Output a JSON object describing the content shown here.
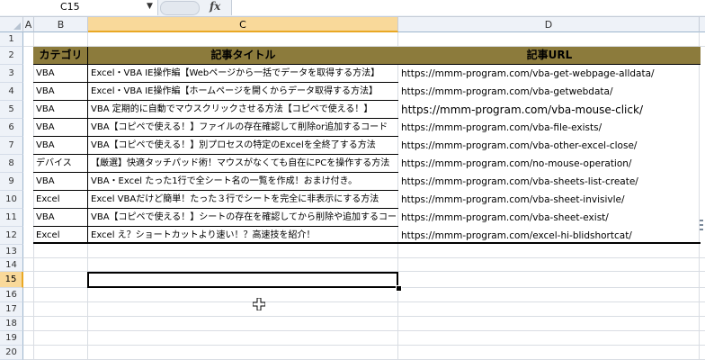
{
  "formula_bar": {
    "name_box": "C15",
    "fx_label": "fx",
    "formula": ""
  },
  "columns": [
    "A",
    "B",
    "C",
    "D"
  ],
  "rows": [
    "1",
    "2",
    "3",
    "4",
    "5",
    "6",
    "7",
    "8",
    "9",
    "10",
    "11",
    "12",
    "13",
    "14",
    "15",
    "16",
    "17",
    "18",
    "19",
    "20"
  ],
  "table": {
    "headers": [
      "カテゴリ",
      "記事タイトル",
      "記事URL"
    ],
    "rows": [
      [
        "VBA",
        "Excel・VBA IE操作編【Webページから一括でデータを取得する方法】",
        "https://mmm-program.com/vba-get-webpage-alldata/"
      ],
      [
        "VBA",
        "Excel・VBA IE操作編【ホームページを開くからデータ取得する方法】",
        "https://mmm-program.com/vba-getwebdata/"
      ],
      [
        "VBA",
        "VBA 定期的に自動でマウスクリックさせる方法【コピペで使える！】",
        "https://mmm-program.com/vba-mouse-click/"
      ],
      [
        "VBA",
        "VBA【コピペで使える！】ファイルの存在確認して削除or追加するコード",
        "https://mmm-program.com/vba-file-exists/"
      ],
      [
        "VBA",
        "VBA【コピペで使える！】別プロセスの特定のExcelを全終了する方法",
        "https://mmm-program.com/vba-other-excel-close/"
      ],
      [
        "デバイス",
        "【厳選】快適タッチパッド術！マウスがなくても自在にPCを操作する方法",
        "https://mmm-program.com/no-mouse-operation/"
      ],
      [
        "VBA",
        "VBA・Excel たった1行で全シート名の一覧を作成！おまけ付き。",
        "https://mmm-program.com/vba-sheets-list-create/"
      ],
      [
        "Excel",
        "Excel VBAだけど簡単！たった３行でシートを完全に非表示にする方法",
        "https://mmm-program.com/vba-sheet-invisivle/"
      ],
      [
        "VBA",
        "VBA【コピペで使える！】シートの存在を確認してから削除や追加するコード！",
        "https://mmm-program.com/vba-sheet-exist/"
      ],
      [
        "Excel",
        "Excel え？ショートカットより速い！？高速技を紹介！",
        "https://mmm-program.com/excel-hi-blidshortcat/"
      ]
    ]
  },
  "selection": {
    "active_cell": "C15"
  },
  "colors": {
    "header_fill": "#8c7b3c",
    "selected_header": "#f9d99a",
    "accent": "#e9a825"
  }
}
